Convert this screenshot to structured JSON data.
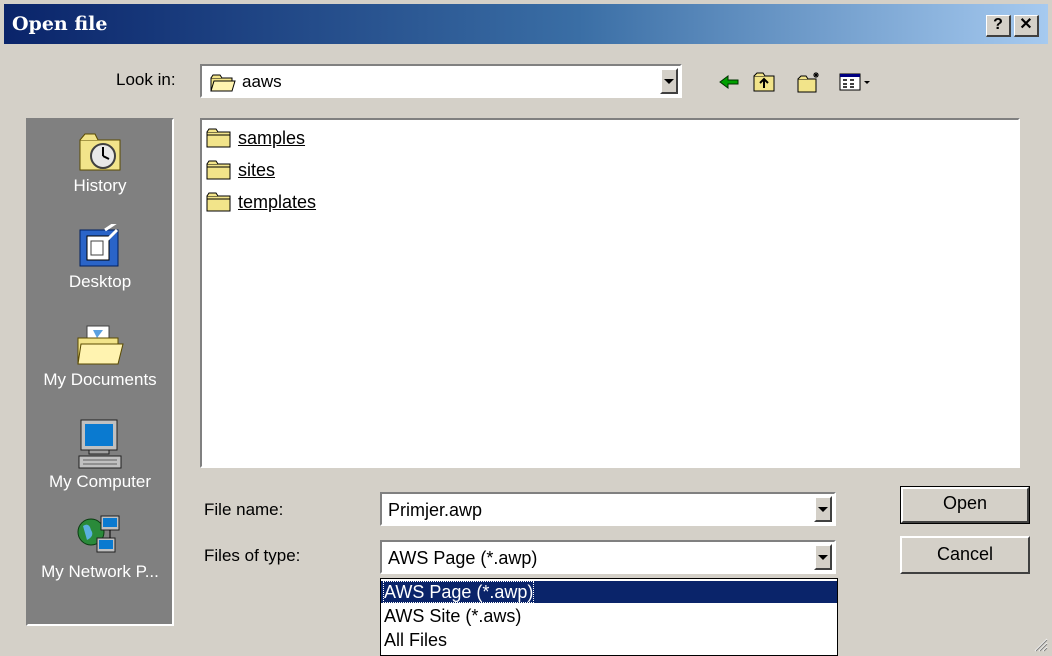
{
  "window": {
    "title": "Open file",
    "help_label": "?",
    "close_label": "✕"
  },
  "look_in": {
    "label": "Look in:",
    "value": "aaws"
  },
  "toolbar": {
    "icons": [
      "back-icon",
      "up-folder-icon",
      "new-folder-icon",
      "view-menu-icon"
    ]
  },
  "places": [
    {
      "label": "History",
      "icon": "history-icon"
    },
    {
      "label": "Desktop",
      "icon": "desktop-icon"
    },
    {
      "label": "My Documents",
      "icon": "my-documents-icon"
    },
    {
      "label": "My Computer",
      "icon": "my-computer-icon"
    },
    {
      "label": "My Network P...",
      "icon": "network-places-icon"
    }
  ],
  "files": [
    {
      "name": "samples"
    },
    {
      "name": "sites"
    },
    {
      "name": "templates"
    }
  ],
  "file_name": {
    "label": "File name:",
    "value": "Primjer.awp"
  },
  "file_type": {
    "label": "Files of type:",
    "value": "AWS Page (*.awp)",
    "options": [
      "AWS Page (*.awp)",
      "AWS Site (*.aws)",
      "All Files"
    ],
    "selected_index": 0
  },
  "buttons": {
    "open": "Open",
    "cancel": "Cancel"
  },
  "colors": {
    "titlebar_start": "#0a246a",
    "titlebar_end": "#a6caf0",
    "selection": "#0a246a",
    "face": "#d4d0c8",
    "places_bg": "#808080"
  }
}
